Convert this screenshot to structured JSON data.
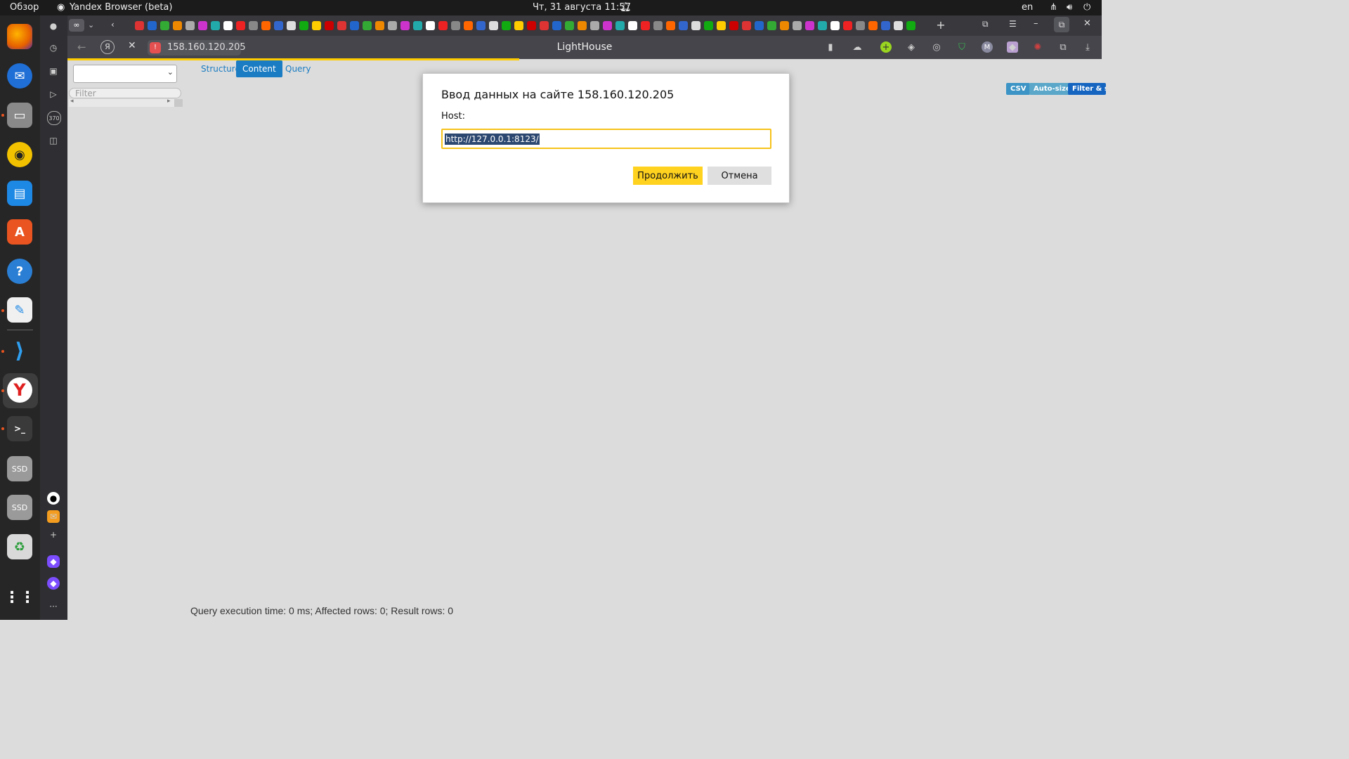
{
  "topbar": {
    "overview": "Обзор",
    "active_app": "Yandex Browser (beta)",
    "datetime": "Чт, 31 августа  11:57",
    "lang": "en"
  },
  "browser": {
    "page_title": "LightHouse",
    "address": "158.160.120.205",
    "side_counter": "370"
  },
  "page": {
    "tabs": [
      "Structure",
      "Content",
      "Query"
    ],
    "active_tab": "Content",
    "filter_placeholder": "Filter",
    "buttons": {
      "csv": "CSV",
      "autosize": "Auto-size",
      "filter": "Filter & so"
    },
    "status": "Query execution time: 0 ms; Affected rows: 0; Result rows: 0"
  },
  "dialog": {
    "title": "Ввод данных на сайте 158.160.120.205",
    "label": "Host:",
    "value": "http://127.0.0.1:8123/",
    "ok": "Продолжить",
    "cancel": "Отмена"
  },
  "dock": {
    "ssd1": "SSD",
    "ssd2": "SSD"
  },
  "colors": {
    "accent": "#ffd21f",
    "active_tab": "#1a7cc2",
    "dock_dot": "#e95420"
  }
}
